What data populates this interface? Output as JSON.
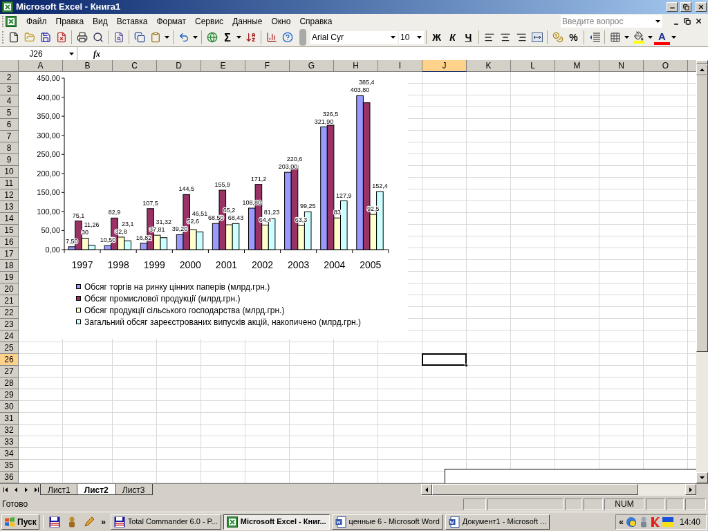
{
  "window": {
    "title": "Microsoft Excel - Книга1"
  },
  "menu": [
    "Файл",
    "Правка",
    "Вид",
    "Вставка",
    "Формат",
    "Сервис",
    "Данные",
    "Окно",
    "Справка"
  ],
  "help_search": {
    "placeholder": "Введите вопрос"
  },
  "toolbar": {
    "sum": "Σ",
    "font": "Arial Cyr",
    "size": "10",
    "bold": "Ж",
    "italic": "К",
    "underline": "Ч",
    "percent": "%",
    "font_color": "A"
  },
  "formula_bar": {
    "name_box": "J26",
    "fx": "fx"
  },
  "columns": [
    {
      "label": "A",
      "selected": false
    },
    {
      "label": "B",
      "selected": false
    },
    {
      "label": "C",
      "selected": false
    },
    {
      "label": "D",
      "selected": false
    },
    {
      "label": "E",
      "selected": false
    },
    {
      "label": "F",
      "selected": false
    },
    {
      "label": "G",
      "selected": false
    },
    {
      "label": "H",
      "selected": false
    },
    {
      "label": "I",
      "selected": false
    },
    {
      "label": "J",
      "selected": true
    },
    {
      "label": "K",
      "selected": false
    },
    {
      "label": "L",
      "selected": false
    },
    {
      "label": "M",
      "selected": false
    },
    {
      "label": "N",
      "selected": false
    },
    {
      "label": "O",
      "selected": false
    }
  ],
  "rows": [
    {
      "label": "2",
      "selected": false
    },
    {
      "label": "3",
      "selected": false
    },
    {
      "label": "4",
      "selected": false
    },
    {
      "label": "5",
      "selected": false
    },
    {
      "label": "6",
      "selected": false
    },
    {
      "label": "7",
      "selected": false
    },
    {
      "label": "8",
      "selected": false
    },
    {
      "label": "9",
      "selected": false
    },
    {
      "label": "10",
      "selected": false
    },
    {
      "label": "11",
      "selected": false
    },
    {
      "label": "12",
      "selected": false
    },
    {
      "label": "13",
      "selected": false
    },
    {
      "label": "14",
      "selected": false
    },
    {
      "label": "15",
      "selected": false
    },
    {
      "label": "16",
      "selected": false
    },
    {
      "label": "17",
      "selected": false
    },
    {
      "label": "18",
      "selected": false
    },
    {
      "label": "19",
      "selected": false
    },
    {
      "label": "20",
      "selected": false
    },
    {
      "label": "21",
      "selected": false
    },
    {
      "label": "22",
      "selected": false
    },
    {
      "label": "23",
      "selected": false
    },
    {
      "label": "24",
      "selected": false
    },
    {
      "label": "25",
      "selected": false
    },
    {
      "label": "26",
      "selected": true
    },
    {
      "label": "27",
      "selected": false
    },
    {
      "label": "28",
      "selected": false
    },
    {
      "label": "29",
      "selected": false
    },
    {
      "label": "30",
      "selected": false
    },
    {
      "label": "31",
      "selected": false
    },
    {
      "label": "32",
      "selected": false
    },
    {
      "label": "33",
      "selected": false
    },
    {
      "label": "34",
      "selected": false
    },
    {
      "label": "35",
      "selected": false
    },
    {
      "label": "36",
      "selected": false
    }
  ],
  "chart": {
    "chart_data": {
      "type": "bar",
      "categories": [
        "1997",
        "1998",
        "1999",
        "2000",
        "2001",
        "2002",
        "2003",
        "2004",
        "2005"
      ],
      "series": [
        {
          "name": "Обсяг торгів на ринку цінних паперів (млрд.грн.)",
          "color": "#9999ff",
          "values": [
            7.5,
            10.5,
            16.82,
            39.2,
            68.5,
            108.8,
            203,
            321.9,
            403.8
          ],
          "value_labels": [
            "7,50",
            "10,50",
            "16,82",
            "39,20",
            "68,50",
            "108,80",
            "203,00",
            "321,90",
            "403,80"
          ]
        },
        {
          "name": "Обсяг промислової продукції (млрд.грн.)",
          "color": "#993366",
          "values": [
            75.1,
            82.9,
            107.5,
            144.5,
            155.9,
            171.2,
            220.6,
            326.5,
            385.4
          ],
          "value_labels": [
            "75,1",
            "82,9",
            "107,5",
            "144,5",
            "155,9",
            "171,2",
            "220,6",
            "326,5",
            "385,4"
          ]
        },
        {
          "name": "Обсяг продукції сільського господарства (млрд.грн.)",
          "color": "#ffffcc",
          "values": [
            30,
            32.8,
            37.81,
            52.6,
            65.2,
            64.4,
            63.3,
            83,
            92.5
          ],
          "value_labels": [
            "30",
            "32,8",
            "37,81",
            "52,6",
            "65,2",
            "64,4",
            "63,3",
            "83",
            "92,5"
          ]
        },
        {
          "name": "Загальний обсяг зареєстрованих випусків акцій, накопичено (млрд.грн.)",
          "color": "#ccffff",
          "values": [
            11.26,
            23.1,
            31.32,
            46.51,
            68.43,
            81.23,
            99.25,
            127.9,
            152.4
          ],
          "value_labels": [
            "11,26",
            "23,1",
            "31,32",
            "46,51",
            "68,43",
            "81,23",
            "99,25",
            "127,9",
            "152,4"
          ]
        }
      ],
      "ylim": [
        0,
        450
      ],
      "yticks": [
        {
          "value": 0,
          "label": "0,00"
        },
        {
          "value": 50,
          "label": "50,00"
        },
        {
          "value": 100,
          "label": "100,00"
        },
        {
          "value": 150,
          "label": "150,00"
        },
        {
          "value": 200,
          "label": "200,00"
        },
        {
          "value": 250,
          "label": "250,00"
        },
        {
          "value": 300,
          "label": "300,00"
        },
        {
          "value": 350,
          "label": "350,00"
        },
        {
          "value": 400,
          "label": "400,00"
        },
        {
          "value": 450,
          "label": "450,00"
        }
      ],
      "legend": "bottom",
      "data_labels": true
    }
  },
  "sheet_tabs": [
    {
      "label": "Лист1",
      "selected": false
    },
    {
      "label": "Лист2",
      "selected": true
    },
    {
      "label": "Лист3",
      "selected": false
    }
  ],
  "status_bar": {
    "status": "Готово",
    "indicator": "NUM"
  },
  "taskbar": {
    "start": "Пуск",
    "more": "»",
    "tasks": [
      {
        "label": "Total Commander 6.0 - P...",
        "selected": false,
        "kind": "commander"
      },
      {
        "label": "Microsoft Excel - Книг...",
        "selected": true,
        "kind": "excel"
      },
      {
        "label": "ценные 6 - Microsoft Word",
        "selected": false,
        "kind": "word"
      },
      {
        "label": "Документ1 - Microsoft ...",
        "selected": false,
        "kind": "word"
      }
    ],
    "tray_toggle": "«",
    "time": "14:40"
  }
}
